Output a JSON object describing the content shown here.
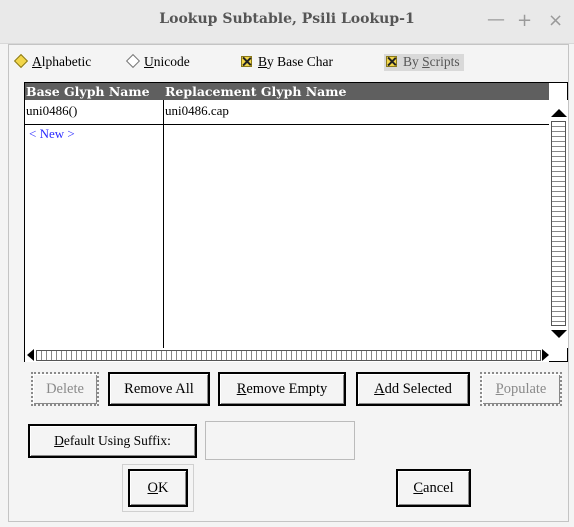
{
  "window": {
    "title": "Lookup Subtable, Psili Lookup-1",
    "controls": {
      "minimize": "—",
      "maximize": "+",
      "close": "×"
    }
  },
  "options": {
    "sort": [
      {
        "label_prefix": "",
        "mnemonic": "A",
        "label_rest": "lphabetic",
        "selected": true
      },
      {
        "label_prefix": "",
        "mnemonic": "U",
        "label_rest": "nicode",
        "selected": false
      }
    ],
    "by_base_char": {
      "mnemonic": "B",
      "label_rest": "y Base Char",
      "checked": true
    },
    "by_scripts": {
      "label_prefix": "By ",
      "mnemonic": "S",
      "label_rest": "cripts",
      "checked": true,
      "disabled": true
    }
  },
  "table": {
    "columns": [
      "Base Glyph Name",
      "Replacement Glyph Name"
    ],
    "rows": [
      {
        "base": "uni0486()",
        "replacement": "uni0486.cap"
      }
    ],
    "new_row_label": "< New >"
  },
  "buttons": {
    "delete": "Delete",
    "remove_all": "Remove All",
    "remove_empty_prefix": "",
    "remove_empty_mnemonic": "R",
    "remove_empty_rest": "emove Empty",
    "add_selected_mnemonic": "A",
    "add_selected_rest": "dd Selected",
    "populate_mnemonic": "P",
    "populate_rest": "opulate",
    "default_suffix_mnemonic": "D",
    "default_suffix_rest": "efault Using Suffix:",
    "ok_mnemonic": "O",
    "ok_rest": "K",
    "cancel_mnemonic": "C",
    "cancel_rest": "ancel"
  },
  "suffix_input": {
    "value": ""
  },
  "colors": {
    "header_bg": "#5f5f5f",
    "new_row": "#2b2bff",
    "checkbox": "#f2d64a"
  }
}
